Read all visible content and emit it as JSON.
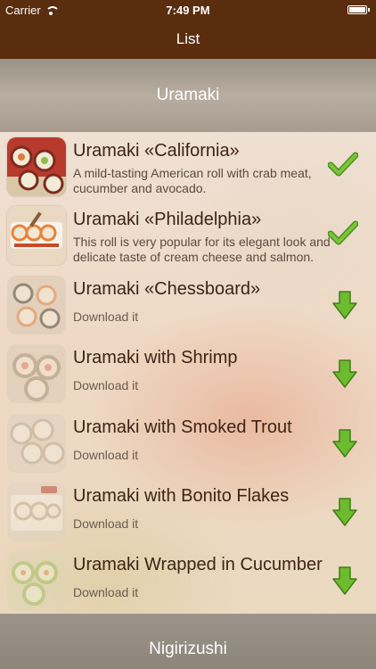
{
  "status_bar": {
    "carrier": "Carrier",
    "time": "7:49 PM"
  },
  "nav": {
    "title": "List"
  },
  "sections": {
    "top": "Uramaki",
    "bottom": "Nigirizushi"
  },
  "items": [
    {
      "title": "Uramaki «California»",
      "description": "A mild-tasting American roll with crab meat, cucumber and avocado.",
      "line1": "A mild-tasting American roll with crab meat,",
      "line2": "cucumber and avocado.",
      "status": "downloaded",
      "status_icon": "checkmark-icon"
    },
    {
      "title": "Uramaki «Philadelphia»",
      "description": "This roll is very popular for its elegant look and delicate taste of cream cheese and salmon.",
      "line1": "This roll is very popular for its elegant look and",
      "line2": "delicate taste of cream cheese and salmon.",
      "status": "downloaded",
      "status_icon": "checkmark-icon"
    },
    {
      "title": "Uramaki «Chessboard»",
      "download_label": "Download it",
      "status": "available",
      "status_icon": "download-arrow-icon"
    },
    {
      "title": "Uramaki with Shrimp",
      "download_label": "Download it",
      "status": "available",
      "status_icon": "download-arrow-icon"
    },
    {
      "title": "Uramaki with Smoked Trout",
      "download_label": "Download it",
      "status": "available",
      "status_icon": "download-arrow-icon"
    },
    {
      "title": "Uramaki with Bonito Flakes",
      "download_label": "Download it",
      "status": "available",
      "status_icon": "download-arrow-icon"
    },
    {
      "title": "Uramaki Wrapped in Cucumber",
      "download_label": "Download it",
      "status": "available",
      "status_icon": "download-arrow-icon"
    }
  ],
  "colors": {
    "nav_background": "#5a2d0f",
    "icon_green": "#5fae2a"
  }
}
